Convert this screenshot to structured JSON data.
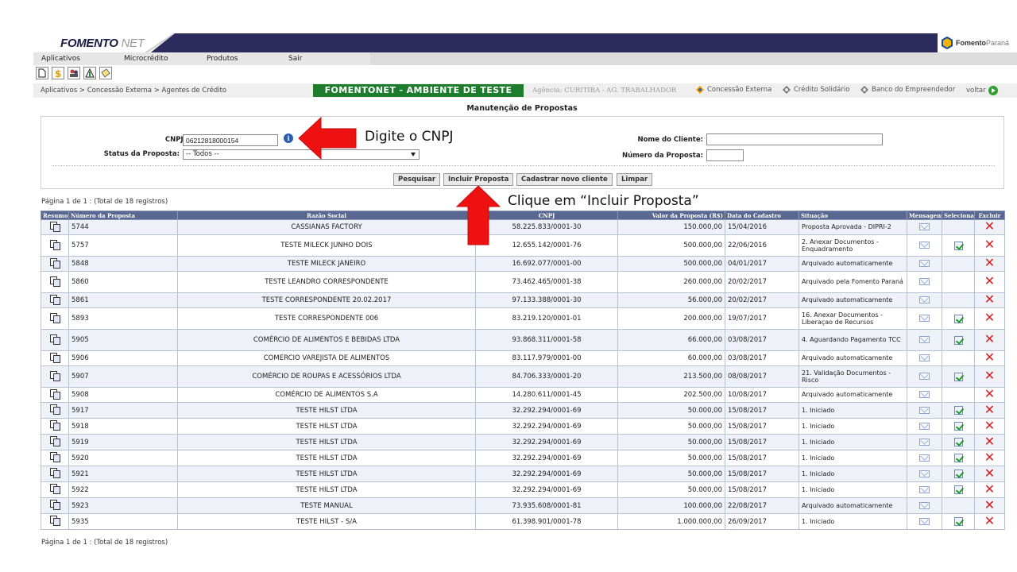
{
  "header": {
    "brand_main": "FOMENTO",
    "brand_suffix": " NET",
    "logo_bold": "Fomento",
    "logo_light": "Paraná"
  },
  "menu": [
    "Aplicativos",
    "Microcrédito",
    "Produtos",
    "Sair"
  ],
  "toolbar_icons": [
    "new-document-icon",
    "money-icon",
    "people-icon",
    "alert-icon",
    "note-icon"
  ],
  "breadcrumb": "Aplicativos > Concessão Externa > Agentes de Crédito",
  "environment_banner": "FOMENTONET - AMBIENTE DE TESTE",
  "agency": "Agência: CURITIBA - AG. TRABALHADOR",
  "quick_links": [
    "Concessão Externa",
    "Crédito Solidário",
    "Banco do Empreendedor"
  ],
  "voltar": "voltar",
  "page_title": "Manutenção de Propostas",
  "filters": {
    "cnpj_label": "CNPJ:",
    "cnpj_value": "06212818000154",
    "status_label": "Status da Proposta:",
    "status_value": "-- Todos --",
    "client_label": "Nome do Cliente:",
    "client_value": "",
    "number_label": "Número da Proposta:",
    "number_value": ""
  },
  "buttons": {
    "search": "Pesquisar",
    "include": "Incluir Proposta",
    "new_client": "Cadastrar novo cliente",
    "clear": "Limpar"
  },
  "pagination_text": "Página 1 de 1 : (Total de 18 registros)",
  "table": {
    "headers": [
      "Resumo",
      "Número da Proposta",
      "Razão Social",
      "CNPJ",
      "Valor da Proposta (R$)",
      "Data do Cadastro",
      "Situação",
      "Mensagens",
      "Selecionar",
      "Excluir"
    ],
    "rows": [
      {
        "num": "5744",
        "razao": "CASSIANAS FACTORY",
        "cnpj": "58.225.833/0001-30",
        "valor": "150.000,00",
        "data": "15/04/2016",
        "situacao": "Proposta Aprovada - DIPRI-2",
        "select": false
      },
      {
        "num": "5757",
        "razao": "TESTE MILECK JUNHO DOIS",
        "cnpj": "12.655.142/0001-76",
        "valor": "500.000,00",
        "data": "22/06/2016",
        "situacao": "2. Anexar Documentos - Enquadramento",
        "select": true
      },
      {
        "num": "5848",
        "razao": "TESTE MILECK JANEIRO",
        "cnpj": "16.692.077/0001-00",
        "valor": "500.000,00",
        "data": "04/01/2017",
        "situacao": "Arquivado automaticamente",
        "select": false
      },
      {
        "num": "5860",
        "razao": "TESTE LEANDRO CORRESPONDENTE",
        "cnpj": "73.462.465/0001-38",
        "valor": "260.000,00",
        "data": "20/02/2017",
        "situacao": "Arquivado pela Fomento Paraná",
        "select": false
      },
      {
        "num": "5861",
        "razao": "TESTE CORRESPONDENTE 20.02.2017",
        "cnpj": "97.133.388/0001-30",
        "valor": "56.000,00",
        "data": "20/02/2017",
        "situacao": "Arquivado automaticamente",
        "select": false
      },
      {
        "num": "5893",
        "razao": "TESTE CORRESPONDENTE 006",
        "cnpj": "83.219.120/0001-01",
        "valor": "200.000,00",
        "data": "19/07/2017",
        "situacao": "16. Anexar Documentos - Liberaçao de Recursos",
        "select": true
      },
      {
        "num": "5905",
        "razao": "COMÉRCIO DE ALIMENTOS E BEBIDAS LTDA",
        "cnpj": "93.868.311/0001-58",
        "valor": "66.000,00",
        "data": "03/08/2017",
        "situacao": "4. Aguardando Pagamento TCC",
        "select": true
      },
      {
        "num": "5906",
        "razao": "COMERCIO VAREJISTA DE ALIMENTOS",
        "cnpj": "83.117.979/0001-00",
        "valor": "60.000,00",
        "data": "03/08/2017",
        "situacao": "Arquivado automaticamente",
        "select": false
      },
      {
        "num": "5907",
        "razao": "COMÉRCIO DE ROUPAS E ACESSÓRIOS LTDA",
        "cnpj": "84.706.333/0001-20",
        "valor": "213.500,00",
        "data": "08/08/2017",
        "situacao": "21. Validação Documentos - Risco",
        "select": true
      },
      {
        "num": "5908",
        "razao": "COMÉRCIO DE ALIMENTOS S.A",
        "cnpj": "14.280.611/0001-45",
        "valor": "202.500,00",
        "data": "10/08/2017",
        "situacao": "Arquivado automaticamente",
        "select": false
      },
      {
        "num": "5917",
        "razao": "TESTE HILST LTDA",
        "cnpj": "32.292.294/0001-69",
        "valor": "50.000,00",
        "data": "15/08/2017",
        "situacao": "1. Iniciado",
        "select": true
      },
      {
        "num": "5918",
        "razao": "TESTE HILST LTDA",
        "cnpj": "32.292.294/0001-69",
        "valor": "50.000,00",
        "data": "15/08/2017",
        "situacao": "1. Iniciado",
        "select": true
      },
      {
        "num": "5919",
        "razao": "TESTE HILST LTDA",
        "cnpj": "32.292.294/0001-69",
        "valor": "50.000,00",
        "data": "15/08/2017",
        "situacao": "1. Iniciado",
        "select": true
      },
      {
        "num": "5920",
        "razao": "TESTE HILST LTDA",
        "cnpj": "32.292.294/0001-69",
        "valor": "50.000,00",
        "data": "15/08/2017",
        "situacao": "1. Iniciado",
        "select": true
      },
      {
        "num": "5921",
        "razao": "TESTE HILST LTDA",
        "cnpj": "32.292.294/0001-69",
        "valor": "50.000,00",
        "data": "15/08/2017",
        "situacao": "1. Iniciado",
        "select": true
      },
      {
        "num": "5922",
        "razao": "TESTE HILST LTDA",
        "cnpj": "32.292.294/0001-69",
        "valor": "50.000,00",
        "data": "15/08/2017",
        "situacao": "1. Iniciado",
        "select": true
      },
      {
        "num": "5923",
        "razao": "TESTE MANUAL",
        "cnpj": "73.935.608/0001-81",
        "valor": "100.000,00",
        "data": "22/08/2017",
        "situacao": "Arquivado automaticamente",
        "select": false
      },
      {
        "num": "5935",
        "razao": "TESTE HILST - S/A",
        "cnpj": "61.398.901/0001-78",
        "valor": "1.000.000,00",
        "data": "26/09/2017",
        "situacao": "1. Iniciado",
        "select": true
      }
    ]
  },
  "annotations": {
    "cnpj_hint": "Digite o CNPJ",
    "include_hint": "Clique em “Incluir Proposta”"
  },
  "colors": {
    "header_navy": "#2d2b5e",
    "banner_green": "#1e7d2c",
    "table_header": "#5a6891",
    "arrow_red": "#ee1111"
  }
}
